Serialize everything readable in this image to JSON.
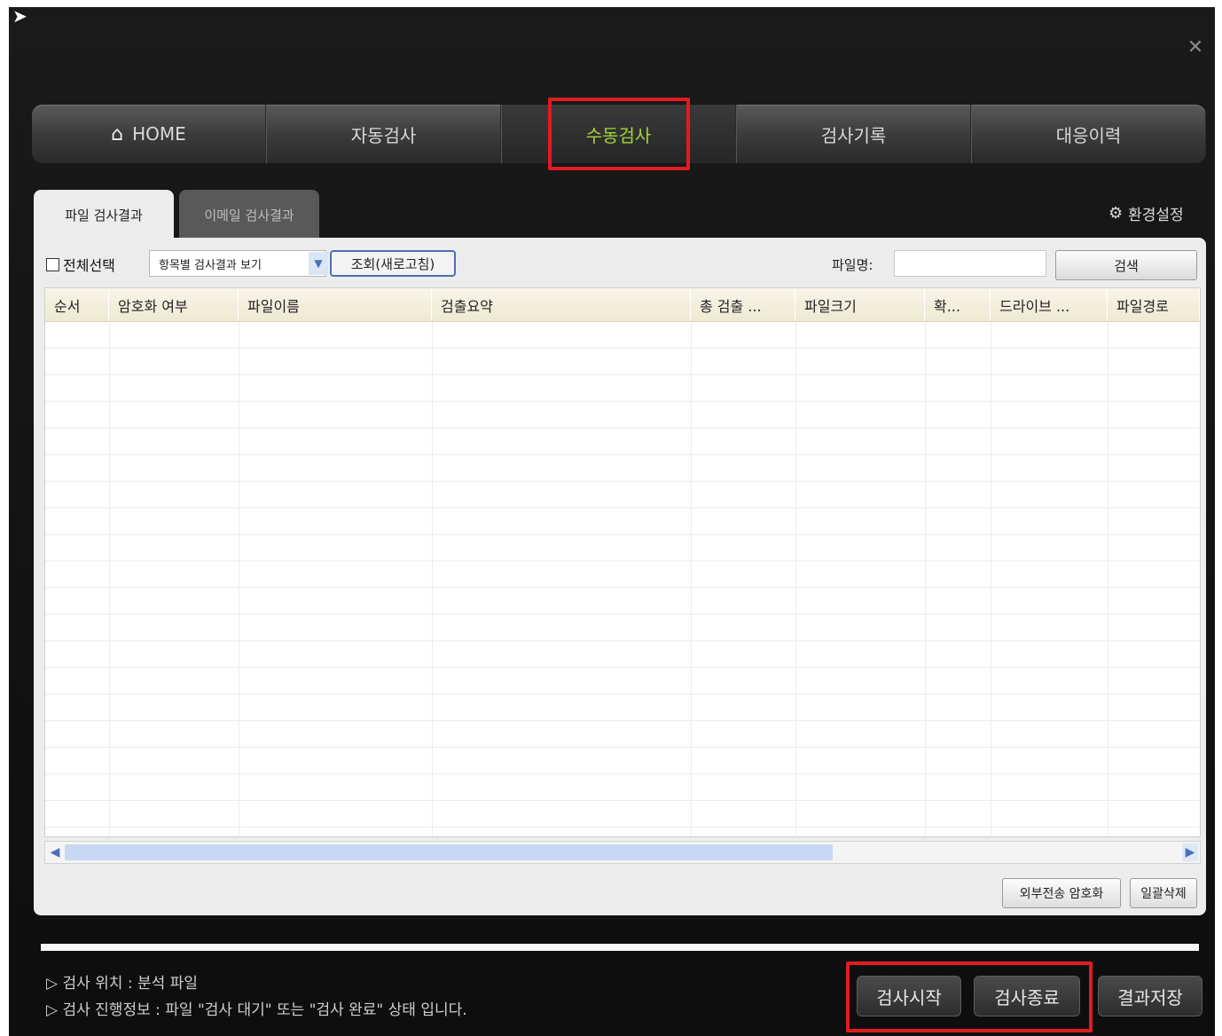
{
  "window": {
    "close_icon": "close-icon"
  },
  "nav": {
    "items": [
      {
        "label": "HOME",
        "icon": "home-icon"
      },
      {
        "label": "자동검사"
      },
      {
        "label": "수동검사",
        "active": true
      },
      {
        "label": "검사기록"
      },
      {
        "label": "대응이력"
      }
    ]
  },
  "subtabs": [
    "파일 검사결과",
    "이메일 검사결과"
  ],
  "env_settings": "환경설정",
  "toolbar": {
    "select_all": "전체선택",
    "view_option": "항목별 검사결과 보기",
    "refresh": "조회(새로고침)",
    "filename_label": "파일명:",
    "filename_value": "",
    "search": "검색"
  },
  "table": {
    "columns": [
      "순서",
      "암호화 여부",
      "파일이름",
      "검출요약",
      "총 검출 ...",
      "파일크기",
      "확...",
      "드라이브 ...",
      "파일경로"
    ],
    "rows": []
  },
  "panel_buttons": [
    "외부전송 암호화",
    "일괄삭제"
  ],
  "status": {
    "line1": "▷ 검사 위치 : 분석 파일",
    "line2": "▷ 검사 진행정보 : 파일 \"검사 대기\" 또는 \"검사 완료\" 상태 입니다."
  },
  "actions": [
    "검사시작",
    "검사종료",
    "결과저장"
  ],
  "colors": {
    "active_nav": "#a4d43a",
    "highlight": "#e11b22",
    "scroll_thumb": "#c6d8f2"
  }
}
